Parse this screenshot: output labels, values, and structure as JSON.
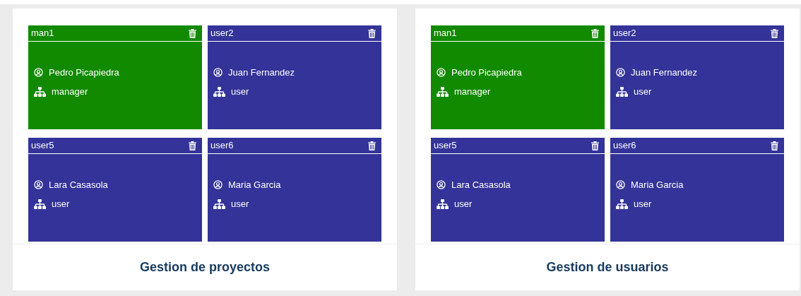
{
  "panels": [
    {
      "title": "Gestion de proyectos",
      "users": [
        {
          "username": "man1",
          "name": "Pedro Picapiedra",
          "role": "manager",
          "color": "#128a00"
        },
        {
          "username": "user2",
          "name": "Juan Fernandez",
          "role": "user",
          "color": "#333399"
        },
        {
          "username": "user5",
          "name": "Lara Casasola",
          "role": "user",
          "color": "#333399"
        },
        {
          "username": "user6",
          "name": "Maria Garcia",
          "role": "user",
          "color": "#333399"
        }
      ]
    },
    {
      "title": "Gestion de usuarios",
      "users": [
        {
          "username": "man1",
          "name": "Pedro Picapiedra",
          "role": "manager",
          "color": "#128a00"
        },
        {
          "username": "user2",
          "name": "Juan Fernandez",
          "role": "user",
          "color": "#333399"
        },
        {
          "username": "user5",
          "name": "Lara Casasola",
          "role": "user",
          "color": "#333399"
        },
        {
          "username": "user6",
          "name": "Maria Garcia",
          "role": "user",
          "color": "#333399"
        }
      ]
    }
  ]
}
